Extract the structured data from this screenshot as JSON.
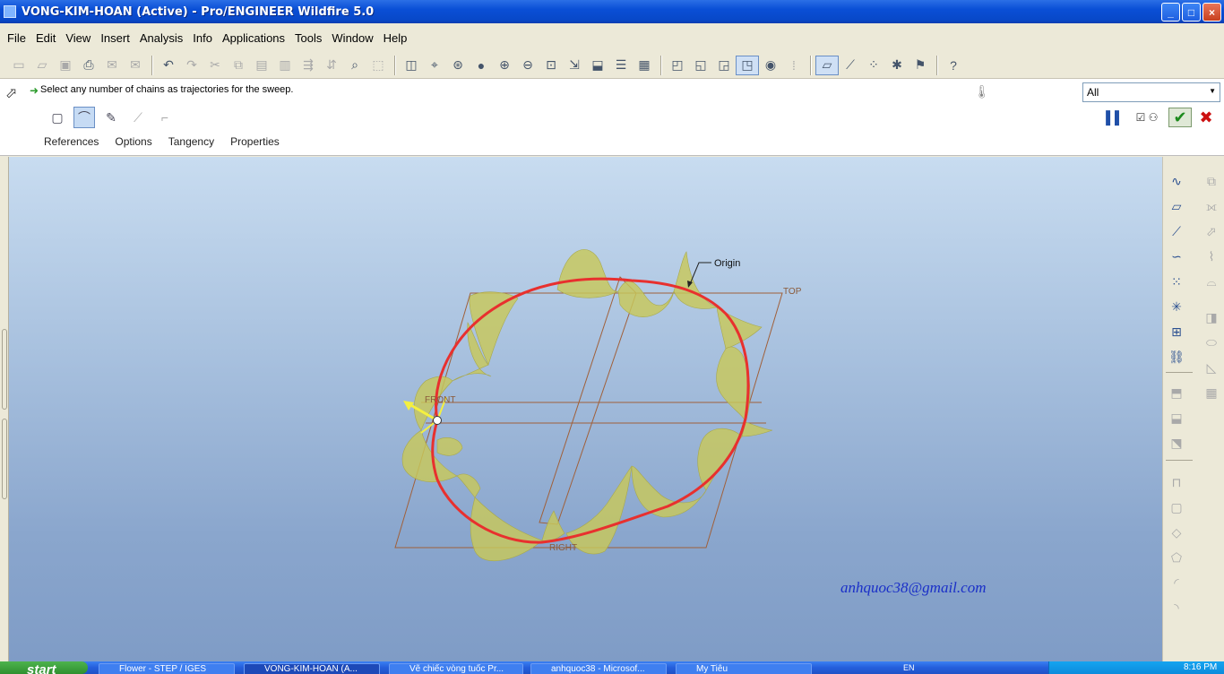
{
  "window": {
    "title": "VONG-KIM-HOAN (Active) - Pro/ENGINEER Wildfire 5.0",
    "minimize": "_",
    "maximize": "□",
    "close": "×"
  },
  "menu": {
    "items": [
      "File",
      "Edit",
      "View",
      "Insert",
      "Analysis",
      "Info",
      "Applications",
      "Tools",
      "Window",
      "Help"
    ]
  },
  "dashboard": {
    "prompt": "Select any number of chains as trajectories for the sweep.",
    "filter_value": "All",
    "tabs": [
      "References",
      "Options",
      "Tangency",
      "Properties"
    ]
  },
  "viewport": {
    "labels": {
      "origin": "Origin",
      "top": "TOP",
      "front": "FRONT",
      "right": "RIGHT"
    },
    "email": "anhquoc38@gmail.com",
    "colors": {
      "trajectory": "#e8302e",
      "surface": "#c8c85a",
      "datum": "#a0603a"
    }
  },
  "taskbar": {
    "start": "start",
    "tasks": [
      "Flower - STEP / IGES",
      "VONG-KIM-HOAN (A...",
      "Vẽ chiếc vòng tuốc Pr...",
      "anhquoc38 - Microsof...",
      "My Tiêu"
    ],
    "quicklaunch": "EN",
    "clock": "8:16 PM"
  }
}
